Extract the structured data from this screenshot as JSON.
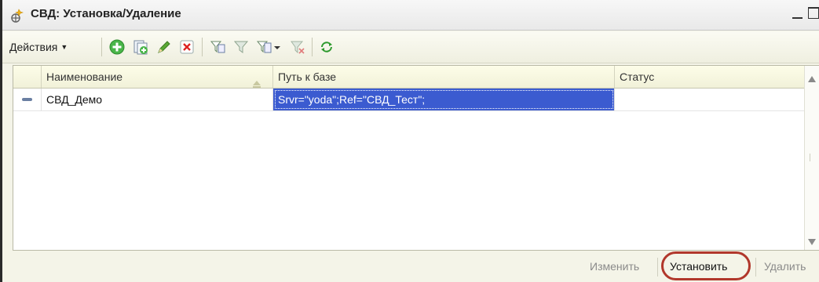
{
  "window": {
    "title": "СВД: Установка/Удаление",
    "controls": [
      "minimize-icon",
      "maximize-icon"
    ]
  },
  "toolbar": {
    "actions_label": "Действия",
    "buttons": [
      {
        "name": "add-icon"
      },
      {
        "name": "copy-icon"
      },
      {
        "name": "edit-icon"
      },
      {
        "name": "delete-icon"
      },
      {
        "name": "filter-set-icon"
      },
      {
        "name": "filter-by-value-icon"
      },
      {
        "name": "filter-history-icon"
      },
      {
        "name": "filter-clear-icon"
      },
      {
        "name": "refresh-icon"
      }
    ]
  },
  "table": {
    "columns": [
      "Наименование",
      "Путь к базе",
      "Статус"
    ],
    "rows": [
      {
        "name": "СВД_Демо",
        "path": "Srvr=\"yoda\";Ref=\"СВД_Тест\";",
        "status": ""
      }
    ],
    "selected_cell": "path"
  },
  "bottom_buttons": {
    "edit": "Изменить",
    "install": "Установить",
    "remove": "Удалить"
  },
  "colors": {
    "selection": "#3b5bd0",
    "highlight_ring": "#b1372b"
  }
}
